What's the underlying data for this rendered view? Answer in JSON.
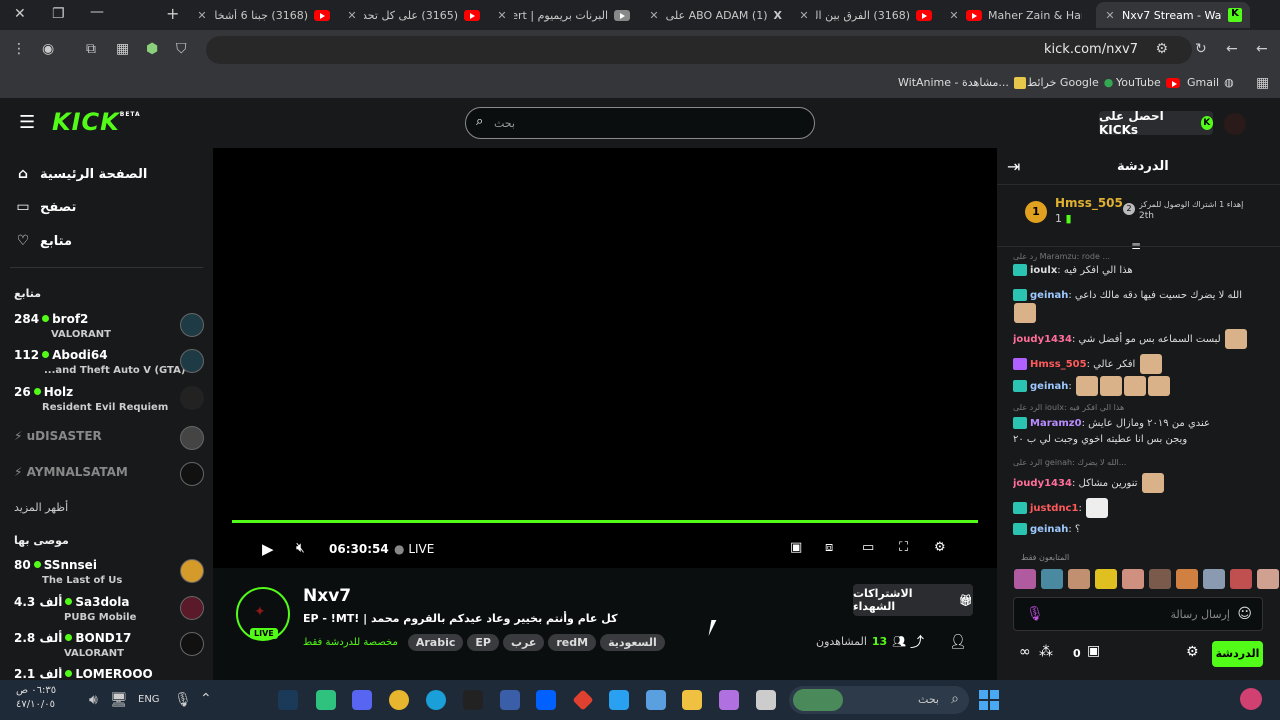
{
  "browser": {
    "tabs": [
      {
        "title": "(3168) جبنا 6 أشخاص"
      },
      {
        "title": "(3165) على كل تحدي"
      },
      {
        "title": "البرنات بريميوم | Alert"
      },
      {
        "title": "(1) ABO ADAM على X"
      },
      {
        "title": "(3168) الفرق بين الملء"
      },
      {
        "title": "Maher Zain & Harris"
      },
      {
        "title": "Nxv7 Stream - Watch"
      }
    ],
    "url": "kick.com/nxv7",
    "bookmarks": [
      {
        "label": "WitAnime - مشاهدة..."
      },
      {
        "label": "خرائط Google"
      },
      {
        "label": "YouTube"
      },
      {
        "label": "Gmail"
      }
    ]
  },
  "kick": {
    "logo": "KICK",
    "logo_sup": "BETA",
    "search_placeholder": "بحث",
    "kicks_button": "احصل على KICKs",
    "nav": [
      {
        "label": "الصفحة الرئيسية",
        "icon": "home-icon"
      },
      {
        "label": "تصفح",
        "icon": "browse-icon"
      },
      {
        "label": "متابع",
        "icon": "heart-icon"
      }
    ],
    "following_header": "متابع",
    "following": [
      {
        "viewers": "284",
        "name": "brof2",
        "game": "VALORANT"
      },
      {
        "viewers": "112",
        "name": "Abodi64",
        "game": "...and Theft Auto V (GTA)"
      },
      {
        "viewers": "26",
        "name": "Holz",
        "game": "Resident Evil Requiem"
      }
    ],
    "offline": [
      "uDISASTER",
      "AYMNALSATAM"
    ],
    "show_more": "أظهر المزيد",
    "recommended_header": "موصى بها",
    "recommended": [
      {
        "viewers": "80",
        "name": "SSnnsei",
        "game": "The Last of Us"
      },
      {
        "viewers": "4.3 ألف",
        "name": "Sa3dola",
        "game": "PUBG Mobile"
      },
      {
        "viewers": "2.8 ألف",
        "name": "BOND17",
        "game": "VALORANT"
      },
      {
        "viewers": "2.1 ألف",
        "name": "LOMEROOO",
        "game": ""
      }
    ],
    "player": {
      "time": "06:30:54",
      "live": "LIVE"
    },
    "stream": {
      "channel": "Nxv7",
      "title": "كل عام وأنتم بخيير وعاد عيدكم بالقروم محمد | !EP - !MT",
      "chat_mode": "مخصصة للدردشة فقط",
      "tags": [
        "Arabic",
        "EP",
        "عرب",
        "redM",
        "السعودية"
      ],
      "live_badge": "LIVE",
      "subs_button": "الاشتراكات الشهداء",
      "viewers_label": "المشاهدون",
      "viewers": "13"
    },
    "chat": {
      "title": "الدردشة",
      "gifter": {
        "name": "Hmss_505",
        "count": "1",
        "rank": "2th",
        "text": "إهداء 1 اشتراك الوصول للمركز"
      },
      "messages": [
        {
          "user": "ioulx",
          "text": "هذا الي افكر فيه",
          "color": "#e8e8e8",
          "reply": "رد على Maramzu: rode ..."
        },
        {
          "user": "geinah",
          "text": "الله لا يضرك حسيت فيها دقه مالك داعي",
          "color": "#9ec9ff"
        },
        {
          "user": "joudy1434",
          "text": "لبست السماعه بس مو أفضل شي",
          "color": "#ff6e9a"
        },
        {
          "user": "Hmss_505",
          "text": "افكر عالي",
          "color": "#ff5a5a"
        },
        {
          "user": "geinah",
          "text": "",
          "color": "#9ec9ff"
        },
        {
          "user": "Maramz0",
          "text": "عندي من ٢٠١٩ ومازال عايش",
          "color": "#b98cff",
          "reply": "الرد على ioulx: هذا الي افكر فيه"
        },
        {
          "user": "",
          "text": "ويجن بس انا عطيته اخوي وجبت لي ب ٢٠",
          "color": "#ddd"
        },
        {
          "user": "joudy1434",
          "text": "تنورين مشاكل",
          "color": "#ff6e9a",
          "reply": "الرد على geinah: الله لا يضرك..."
        },
        {
          "user": "justdnc1",
          "text": "",
          "color": "#ff5a5a"
        },
        {
          "user": "geinah",
          "text": "؟",
          "color": "#9ec9ff"
        }
      ],
      "viewers_label": "المتابعون فقط",
      "input_placeholder": "إرسال رسالة",
      "send_button": "الدردشة",
      "points": "0"
    }
  },
  "taskbar": {
    "time": "٠٦:٣٥ ص",
    "date": "٤٧/١٠/٠٥",
    "lang": "ENG",
    "search": "بحث"
  }
}
